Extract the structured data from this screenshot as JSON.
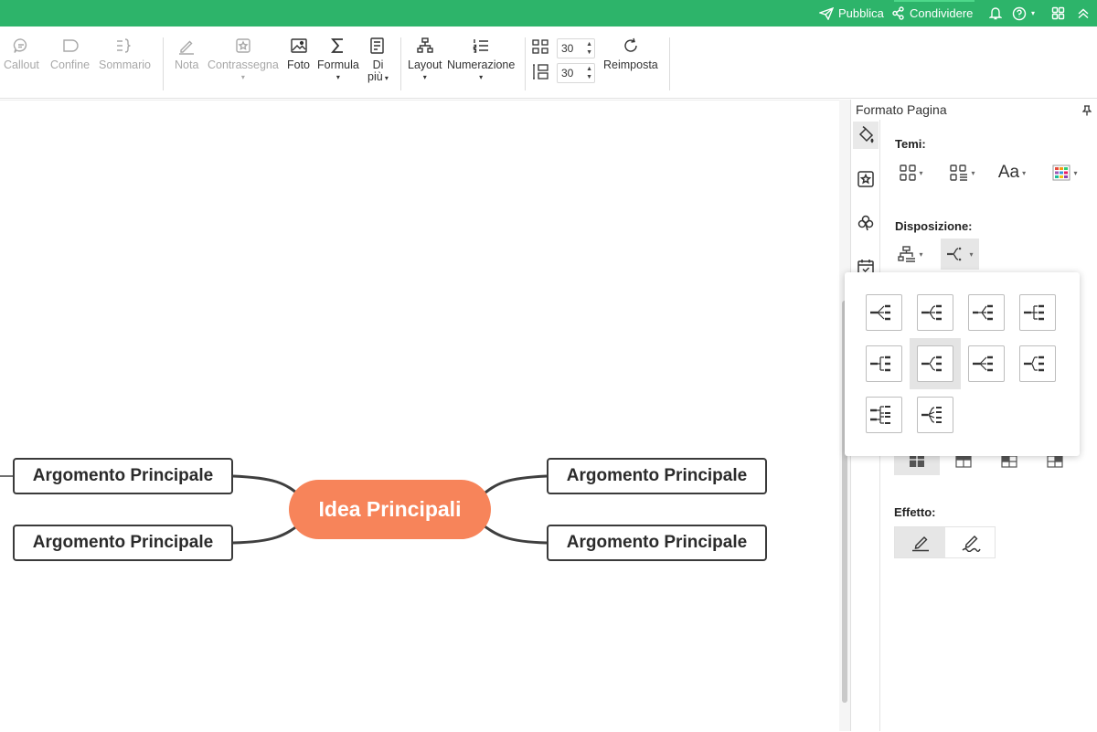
{
  "topbar": {
    "publish_label": "Pubblica",
    "share_label": "Condividere",
    "bg_color": "#2db46a"
  },
  "toolbar": {
    "callout": "Callout",
    "boundary": "Confine",
    "summary": "Sommario",
    "note": "Nota",
    "mark": "Contrassegna",
    "photo": "Foto",
    "formula": "Formula",
    "more_line1": "Di",
    "more_line2": "più",
    "layout": "Layout",
    "numbering": "Numerazione",
    "h_spacing": "30",
    "v_spacing": "30",
    "reset": "Reimposta"
  },
  "mindmap": {
    "central": "Idea Principali",
    "central_color": "#f7845a",
    "topics": [
      "Argomento Principale",
      "Argomento Principale",
      "Argomento Principale",
      "Argomento Principale"
    ]
  },
  "panel": {
    "title": "Formato Pagina",
    "themes_label": "Temi:",
    "layout_label": "Disposizione:",
    "effect_label": "Effetto:",
    "font_button": "Aa"
  },
  "icons": {
    "publish": "send-icon",
    "share": "share-icon",
    "bell": "bell-icon",
    "help": "help-icon",
    "apps": "apps-icon",
    "collapse": "chevron-up-icon"
  }
}
